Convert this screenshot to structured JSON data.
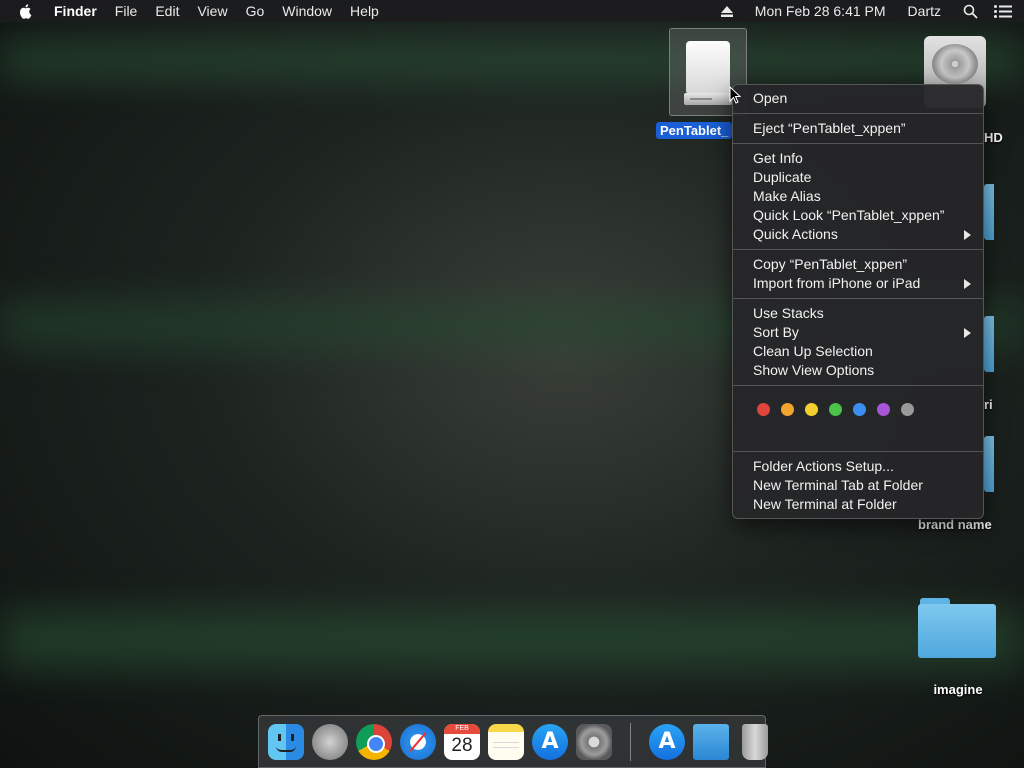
{
  "menubar": {
    "app_name": "Finder",
    "menus": [
      "File",
      "Edit",
      "View",
      "Go",
      "Window",
      "Help"
    ],
    "datetime": "Mon Feb 28  6:41 PM",
    "user": "Dartz",
    "icons": [
      "apple-icon",
      "eject-icon",
      "spotlight-search-icon",
      "notification-center-icon"
    ]
  },
  "desktop": {
    "selected_volume": {
      "label": "PenTablet_",
      "icon": "removable-drive-icon"
    },
    "hard_drive": {
      "label": "HD",
      "icon": "hard-drive-icon"
    },
    "items": [
      {
        "label": "ri",
        "icon": "folder-icon"
      },
      {
        "label": "brand name",
        "icon": "folder-icon"
      },
      {
        "label": "imagine",
        "icon": "folder-icon"
      }
    ]
  },
  "context_menu": {
    "groups": [
      [
        {
          "label": "Open"
        }
      ],
      [
        {
          "label": "Eject “PenTablet_xppen”"
        }
      ],
      [
        {
          "label": "Get Info"
        },
        {
          "label": "Duplicate"
        },
        {
          "label": "Make Alias"
        },
        {
          "label": "Quick Look “PenTablet_xppen”"
        },
        {
          "label": "Quick Actions",
          "submenu": true
        }
      ],
      [
        {
          "label": "Copy “PenTablet_xppen”"
        },
        {
          "label": "Import from iPhone or iPad",
          "submenu": true
        }
      ],
      [
        {
          "label": "Use Stacks"
        },
        {
          "label": "Sort By",
          "submenu": true
        },
        {
          "label": "Clean Up Selection"
        },
        {
          "label": "Show View Options"
        }
      ]
    ],
    "tag_colors": [
      "#e0443e",
      "#f2a42e",
      "#f2d12e",
      "#4cc24a",
      "#3b8ff0",
      "#a557d8",
      "#9a9a9a"
    ],
    "tag_names": [
      "red-tag",
      "orange-tag",
      "yellow-tag",
      "green-tag",
      "blue-tag",
      "purple-tag",
      "gray-tag"
    ],
    "footer_items": [
      {
        "label": "Folder Actions Setup..."
      },
      {
        "label": "New Terminal Tab at Folder"
      },
      {
        "label": "New Terminal at Folder"
      }
    ]
  },
  "dock": {
    "apps": [
      {
        "name": "finder",
        "running": true
      },
      {
        "name": "launchpad",
        "running": false
      },
      {
        "name": "chrome",
        "running": true
      },
      {
        "name": "safari",
        "running": false
      },
      {
        "name": "calendar",
        "running": false,
        "month": "FEB",
        "day": "28"
      },
      {
        "name": "notes",
        "running": false
      },
      {
        "name": "app-store",
        "running": false
      },
      {
        "name": "system-preferences",
        "running": false
      }
    ],
    "right_items": [
      {
        "name": "applications-stack"
      },
      {
        "name": "downloads-stack"
      },
      {
        "name": "trash"
      }
    ]
  }
}
